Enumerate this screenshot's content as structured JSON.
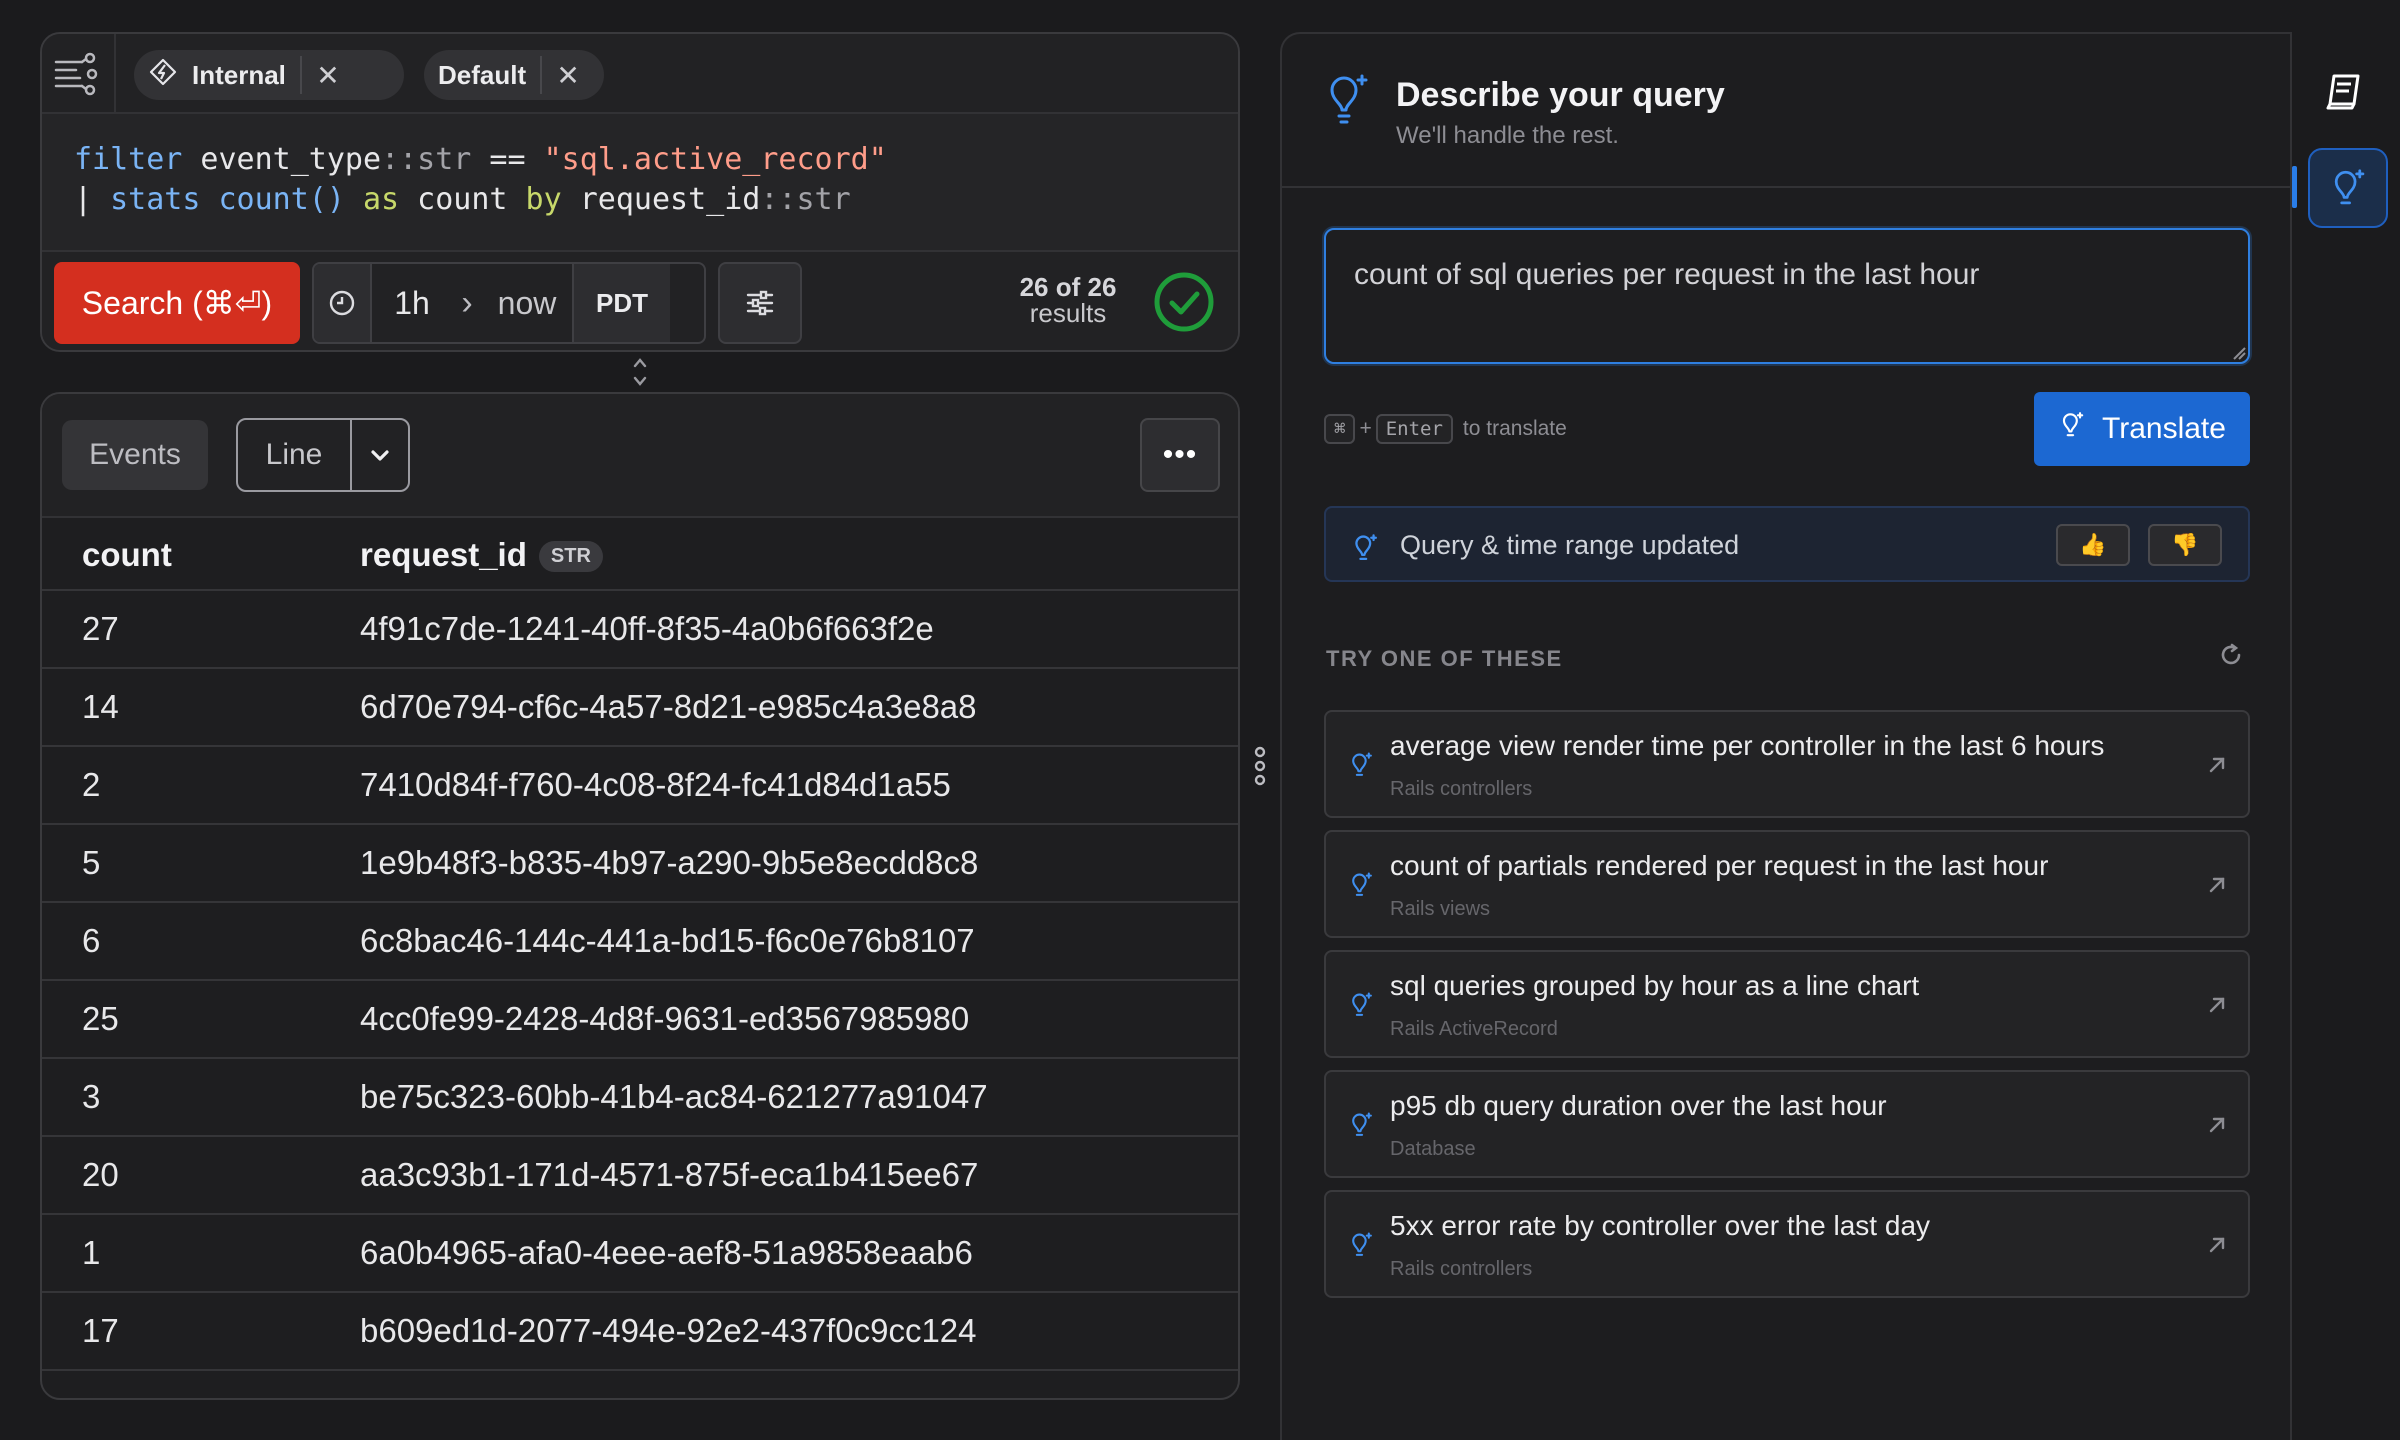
{
  "query_card": {
    "tabs": [
      {
        "label": "Internal"
      },
      {
        "label": "Default"
      }
    ],
    "close_glyph": "✕",
    "query_lines": {
      "l1_kw": "filter",
      "l1_field": " event_type",
      "l1_type": "::str",
      "l1_op": " == ",
      "l1_str": "\"sql.active_record\"",
      "l2_pipe": "| ",
      "l2_kw": "stats",
      "l2_fn": " count()",
      "l2_as": " as",
      "l2_alias": " count",
      "l2_by": " by",
      "l2_field": " request_id",
      "l2_type": "::str"
    },
    "search_label": "Search (⌘⏎)",
    "range_start": "1h",
    "range_arrow": "›",
    "range_end": "now",
    "timezone": "PDT",
    "results_count": "26 of 26",
    "results_word": "results"
  },
  "results": {
    "events_label": "Events",
    "viz_value": "Line",
    "more_label": "•••",
    "columns": [
      {
        "name": "count",
        "type": ""
      },
      {
        "name": "request_id",
        "type": "STR"
      }
    ],
    "rows": [
      {
        "count": "27",
        "request_id": "4f91c7de-1241-40ff-8f35-4a0b6f663f2e"
      },
      {
        "count": "14",
        "request_id": "6d70e794-cf6c-4a57-8d21-e985c4a3e8a8"
      },
      {
        "count": "2",
        "request_id": "7410d84f-f760-4c08-8f24-fc41d84d1a55"
      },
      {
        "count": "5",
        "request_id": "1e9b48f3-b835-4b97-a290-9b5e8ecdd8c8"
      },
      {
        "count": "6",
        "request_id": "6c8bac46-144c-441a-bd15-f6c0e76b8107"
      },
      {
        "count": "25",
        "request_id": "4cc0fe99-2428-4d8f-9631-ed3567985980"
      },
      {
        "count": "3",
        "request_id": "be75c323-60bb-41b4-ac84-621277a91047"
      },
      {
        "count": "20",
        "request_id": "aa3c93b1-171d-4571-875f-eca1b415ee67"
      },
      {
        "count": "1",
        "request_id": "6a0b4965-afa0-4eee-aef8-51a9858eaab6"
      },
      {
        "count": "17",
        "request_id": "b609ed1d-2077-494e-92e2-437f0c9cc124"
      }
    ]
  },
  "assistant": {
    "title": "Describe your query",
    "subtitle": "We'll handle the rest.",
    "prompt_value": "count of sql queries per request in the last hour",
    "hint_key1": "⌘",
    "hint_plus": "+",
    "hint_key2": "Enter",
    "hint_text": "to translate",
    "translate_label": "Translate",
    "banner_text": "Query & time range updated",
    "vote_up": "👍",
    "vote_down": "👎",
    "suggest_header": "TRY ONE OF THESE",
    "suggestions": [
      {
        "title": "average view render time per controller in the last 6 hours",
        "tag": "Rails controllers"
      },
      {
        "title": "count of partials rendered per request in the last hour",
        "tag": "Rails views"
      },
      {
        "title": "sql queries grouped by hour as a line chart",
        "tag": "Rails ActiveRecord"
      },
      {
        "title": "p95 db query duration over the last hour",
        "tag": "Database"
      },
      {
        "title": "5xx error rate by controller over the last day",
        "tag": "Rails controllers"
      }
    ]
  },
  "colors": {
    "accent_blue": "#1c68d2",
    "search_red": "#d42f1f",
    "ok_green": "#1f9d3a"
  }
}
